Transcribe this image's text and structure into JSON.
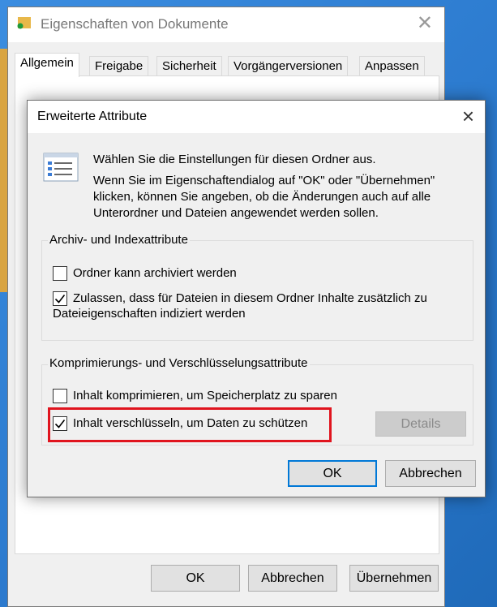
{
  "back_window": {
    "title": "Eigenschaften von Dokumente",
    "tabs": [
      "Allgemein",
      "Freigabe",
      "Sicherheit",
      "Vorgängerversionen",
      "Anpassen"
    ],
    "buttons": {
      "ok": "OK",
      "cancel": "Abbrechen",
      "apply": "Übernehmen"
    }
  },
  "dialog": {
    "title": "Erweiterte Attribute",
    "intro_line1": "Wählen Sie die Einstellungen für diesen Ordner aus.",
    "intro_line2": "Wenn Sie im Eigenschaftendialog auf \"OK\" oder \"Übernehmen\" klicken, können Sie angeben, ob die Änderungen auch auf alle Unterordner und Dateien angewendet werden sollen.",
    "archive_group": {
      "label": "Archiv- und Indexattribute",
      "items": [
        {
          "label": "Ordner kann archiviert werden",
          "checked": false
        },
        {
          "label_line1": "Zulassen, dass für Dateien in diesem Ordner Inhalte zusätzlich zu",
          "label_line2": "Dateieigenschaften indiziert werden",
          "checked": true
        }
      ]
    },
    "compress_group": {
      "label": "Komprimierungs- und Verschlüsselungsattribute",
      "items": [
        {
          "label": "Inhalt komprimieren, um Speicherplatz zu sparen",
          "checked": false
        },
        {
          "label": "Inhalt verschlüsseln, um Daten zu schützen",
          "checked": true
        }
      ],
      "details_label": "Details"
    },
    "buttons": {
      "ok": "OK",
      "cancel": "Abbrechen"
    },
    "highlight_color": "#e0141e"
  }
}
